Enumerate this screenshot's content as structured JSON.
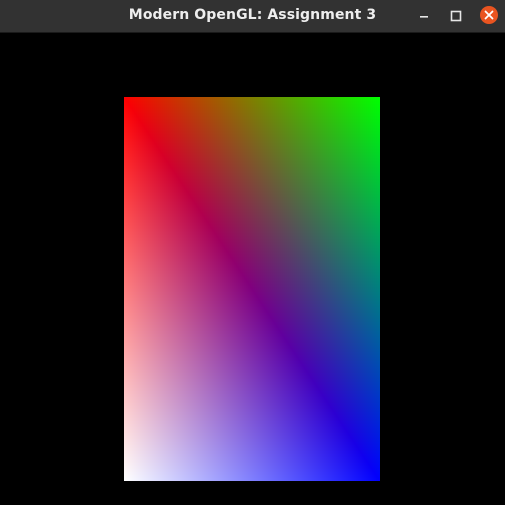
{
  "window": {
    "title": "Modern OpenGL: Assignment 3",
    "buttons": {
      "minimize_icon": "minimize-icon",
      "maximize_icon": "maximize-icon",
      "close_icon": "close-icon"
    },
    "colors": {
      "titlebar": "#323232",
      "title_text": "#eeeeee",
      "close_button": "#e95420",
      "background": "#000000"
    }
  },
  "render": {
    "shape": "rectangle",
    "corner_colors": {
      "top_left": "#ff0000",
      "top_right": "#00ff00",
      "bottom_right": "#0000ff",
      "bottom_left": "#ffffff"
    }
  }
}
